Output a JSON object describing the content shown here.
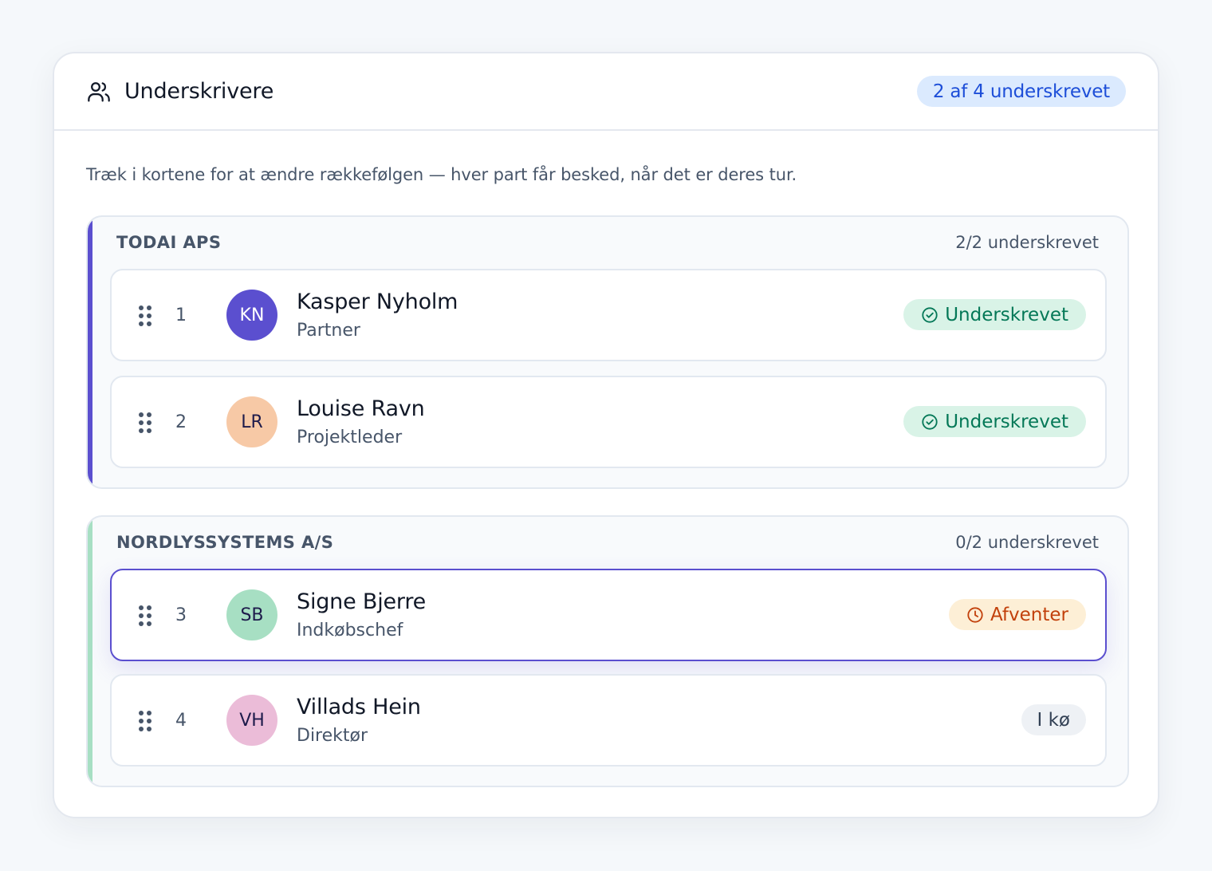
{
  "header": {
    "title": "Underskrivere",
    "icon": "users-icon",
    "progress_label": "2 af 4 underskrevet"
  },
  "instruction": "Træk i kortene for at ændre rækkefølgen — hver part får besked, når det er deres tur.",
  "colors": {
    "primary": "#5b4fcf",
    "signed": "#047857",
    "pending": "#c2410c",
    "group1_accent": "#5b4fcf",
    "group2_accent": "#a7dfc3"
  },
  "groups": [
    {
      "name": "TODAI APS",
      "count_label": "2/2 underskrevet",
      "signers": [
        {
          "order": "1",
          "initials": "KN",
          "name": "Kasper Nyholm",
          "role": "Partner",
          "status": "Underskrevet",
          "status_icon": "check-circle-icon",
          "avatar_bg": "#5b4fcf",
          "avatar_fg": "#ffffff"
        },
        {
          "order": "2",
          "initials": "LR",
          "name": "Louise Ravn",
          "role": "Projektleder",
          "status": "Underskrevet",
          "status_icon": "check-circle-icon",
          "avatar_bg": "#f7c9a6",
          "avatar_fg": "#1e1b4b"
        }
      ]
    },
    {
      "name": "NORDLYSSYSTEMS A/S",
      "count_label": "0/2 underskrevet",
      "signers": [
        {
          "order": "3",
          "initials": "SB",
          "name": "Signe Bjerre",
          "role": "Indkøbschef",
          "status": "Afventer",
          "status_icon": "clock-icon",
          "avatar_bg": "#a7dfc3",
          "avatar_fg": "#1e1b4b"
        },
        {
          "order": "4",
          "initials": "VH",
          "name": "Villads Hein",
          "role": "Direktør",
          "status": "I kø",
          "status_icon": "",
          "avatar_bg": "#ebbcd8",
          "avatar_fg": "#1e1b4b"
        }
      ]
    }
  ]
}
